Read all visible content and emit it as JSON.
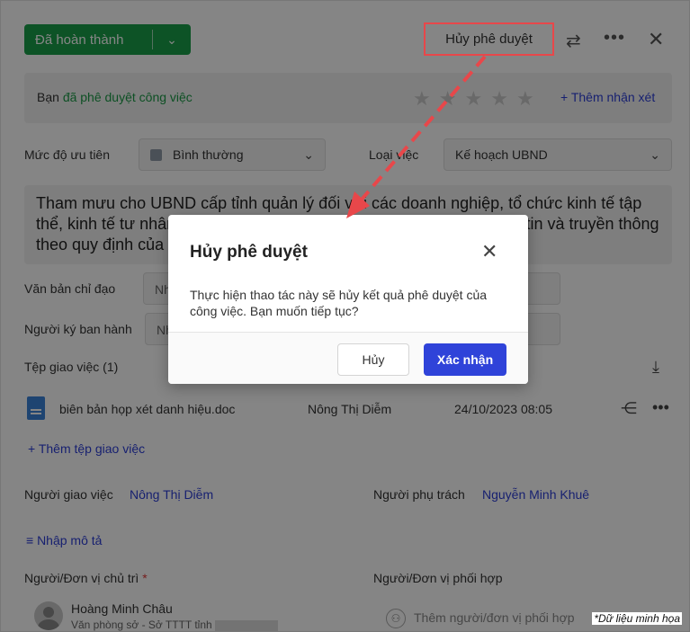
{
  "header": {
    "status_label": "Đã hoàn thành",
    "cancel_approval_label": "Hủy phê duyệt"
  },
  "approval_bar": {
    "prefix": "Bạn",
    "status_text": "đã phê duyệt công việc",
    "stars_total": 5,
    "stars_filled": 0,
    "add_review_label": "Thêm nhận xét"
  },
  "fields": {
    "priority_label": "Mức độ ưu tiên",
    "priority_value": "Bình thường",
    "task_type_label": "Loại việc",
    "task_type_value": "Kế hoạch UBND",
    "description": "Tham mưu cho UBND cấp tỉnh quản lý đối với các doanh nghiệp, tổ chức kinh tế tập thể, kinh tế tư nhân hoạt động trên địa bàn tỉnh trong lĩnh vực thông tin và truyền thông theo quy định của pháp luật",
    "directive_doc_label": "Văn bản chỉ đạo",
    "directive_doc_value": "Nh",
    "signer_label": "Người ký ban hành",
    "signer_value": "Nh"
  },
  "files": {
    "title": "Tệp giao việc (1)",
    "rows": [
      {
        "name": "biên bản họp xét danh hiệu.doc",
        "owner": "Nông Thị Diễm",
        "date": "24/10/2023 08:05"
      }
    ],
    "add_label": "Thêm tệp giao việc"
  },
  "people": {
    "assigner_label": "Người giao việc",
    "assigner_name": "Nông Thị Diễm",
    "owner_label": "Người phụ trách",
    "owner_name": "Nguyễn Minh Khuê",
    "add_desc_label": "Nhập mô tả",
    "lead_label": "Người/Đơn vị chủ trì",
    "lead_required": "*",
    "coop_label": "Người/Đơn vị phối hợp",
    "lead_person_name": "Hoàng Minh Châu",
    "lead_person_unit": "Văn phòng sở - Sở TTTT tỉnh",
    "add_coop_label": "Thêm người/đơn vị phối hợp"
  },
  "dialog": {
    "title": "Hủy phê duyệt",
    "message": "Thực hiện thao tác này sẽ hủy kết quả phê duyệt của công việc. Bạn muốn tiếp tục?",
    "cancel_label": "Hủy",
    "confirm_label": "Xác nhận"
  },
  "watermark": "*Dữ liệu minh họa",
  "colors": {
    "status_green": "#1aa04a",
    "primary_blue": "#2f43d9",
    "annotation_red": "#e8474a"
  }
}
